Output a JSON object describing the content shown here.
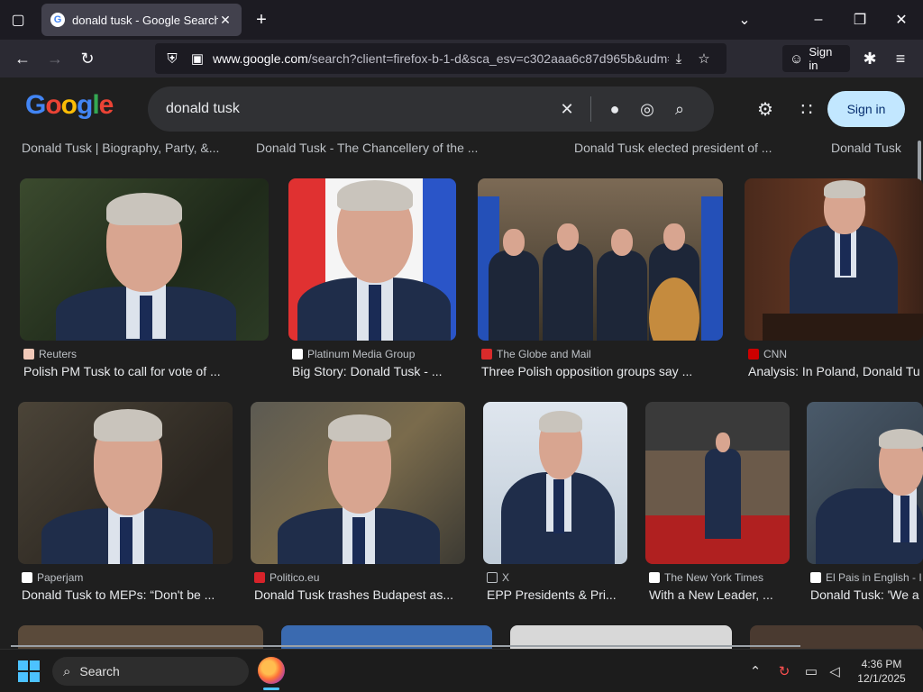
{
  "browser": {
    "tab_title": "donald tusk - Google Search",
    "url_host": "www.google.com",
    "url_path": "/search?client=firefox-b-1-d&sca_esv=c302aaa6c87d965b&udm=",
    "signin_label": "Sign in"
  },
  "google": {
    "query": "donald tusk",
    "signin_label": "Sign in"
  },
  "top_captions": [
    "Donald Tusk | Biography, Party, &...",
    "Donald Tusk - The Chancellery of the ...",
    "Donald Tusk elected president of ...",
    "Donald Tusk"
  ],
  "results_row1": [
    {
      "source": "Reuters",
      "caption": "Polish PM Tusk to call for vote of ...",
      "source_color": "#f0c8b8"
    },
    {
      "source": "Platinum Media Group",
      "caption": "Big Story: Donald Tusk - ...",
      "source_color": "#ffffff"
    },
    {
      "source": "The Globe and Mail",
      "caption": "Three Polish opposition groups say ...",
      "source_color": "#d92b2b"
    },
    {
      "source": "CNN",
      "caption": "Analysis: In Poland, Donald Tu",
      "source_color": "#cc0000"
    }
  ],
  "results_row2": [
    {
      "source": "Paperjam",
      "caption": "Donald Tusk to MEPs: “Don't be ...",
      "source_color": "#ffffff"
    },
    {
      "source": "Politico.eu",
      "caption": "Donald Tusk trashes Budapest as...",
      "source_color": "#d8232a"
    },
    {
      "source": "X",
      "caption": "EPP Presidents & Pri...",
      "source_color": "#1f1f1f"
    },
    {
      "source": "The New York Times",
      "caption": "With a New Leader, ...",
      "source_color": "#ffffff"
    },
    {
      "source": "El Pais in English - I",
      "caption": "Donald Tusk: 'We a",
      "source_color": "#ffffff"
    }
  ],
  "taskbar": {
    "search_label": "Search",
    "time": "4:36 PM",
    "date": "12/1/2025"
  },
  "icons": {
    "tab_list": "▢",
    "tab_close": "✕",
    "new_tab": "+",
    "chevron": "⌄",
    "minimize": "–",
    "maximize": "❐",
    "close": "✕",
    "back": "←",
    "forward": "→",
    "reload": "↻",
    "shield": "⛨",
    "lock": "▣",
    "download": "⤓",
    "star": "☆",
    "account": "☺",
    "extensions": "✱",
    "menu": "≡",
    "clear": "✕",
    "mic": "●",
    "lens": "◎",
    "search": "⌕",
    "settings": "⚙",
    "apps": "∷",
    "tray_up": "⌃",
    "sync": "↻",
    "network": "▭",
    "volume": "◁"
  }
}
